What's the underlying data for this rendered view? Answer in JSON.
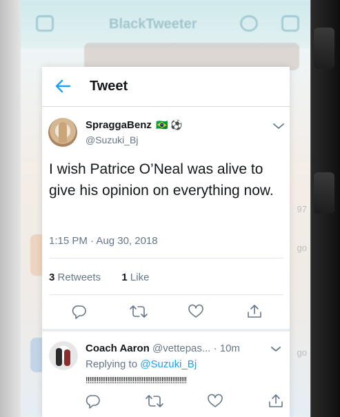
{
  "background_app": {
    "title": "BlackTweeter",
    "side_texts": [
      "97",
      "go",
      "go"
    ]
  },
  "header": {
    "back_icon": "back-arrow-icon",
    "title": "Tweet"
  },
  "tweet": {
    "display_name": "SpraggaBenz",
    "name_emojis": "🇧🇷 ⚽",
    "handle": "@Suzuki_Bj",
    "text": "I wish Patrice O’Neal was alive to give his opinion on everything now.",
    "timestamp": "1:15 PM · Aug 30, 2018",
    "retweets_count": "3",
    "retweets_label": "Retweets",
    "likes_count": "1",
    "likes_label": "Like"
  },
  "reply": {
    "display_name": "Coach Aaron",
    "handle": "@vettepas...",
    "time": "· 10m",
    "replying_prefix": "Replying to",
    "replying_mention": "@Suzuki_Bj",
    "text": "!!!!!!!!!!!!!!!!!!!!!!!!!!!!!!!!!!!!!!!!!!!!!!!!!!!!!!!!"
  },
  "colors": {
    "accent": "#1da1f2",
    "text_primary": "#14171a",
    "text_secondary": "#657786"
  }
}
